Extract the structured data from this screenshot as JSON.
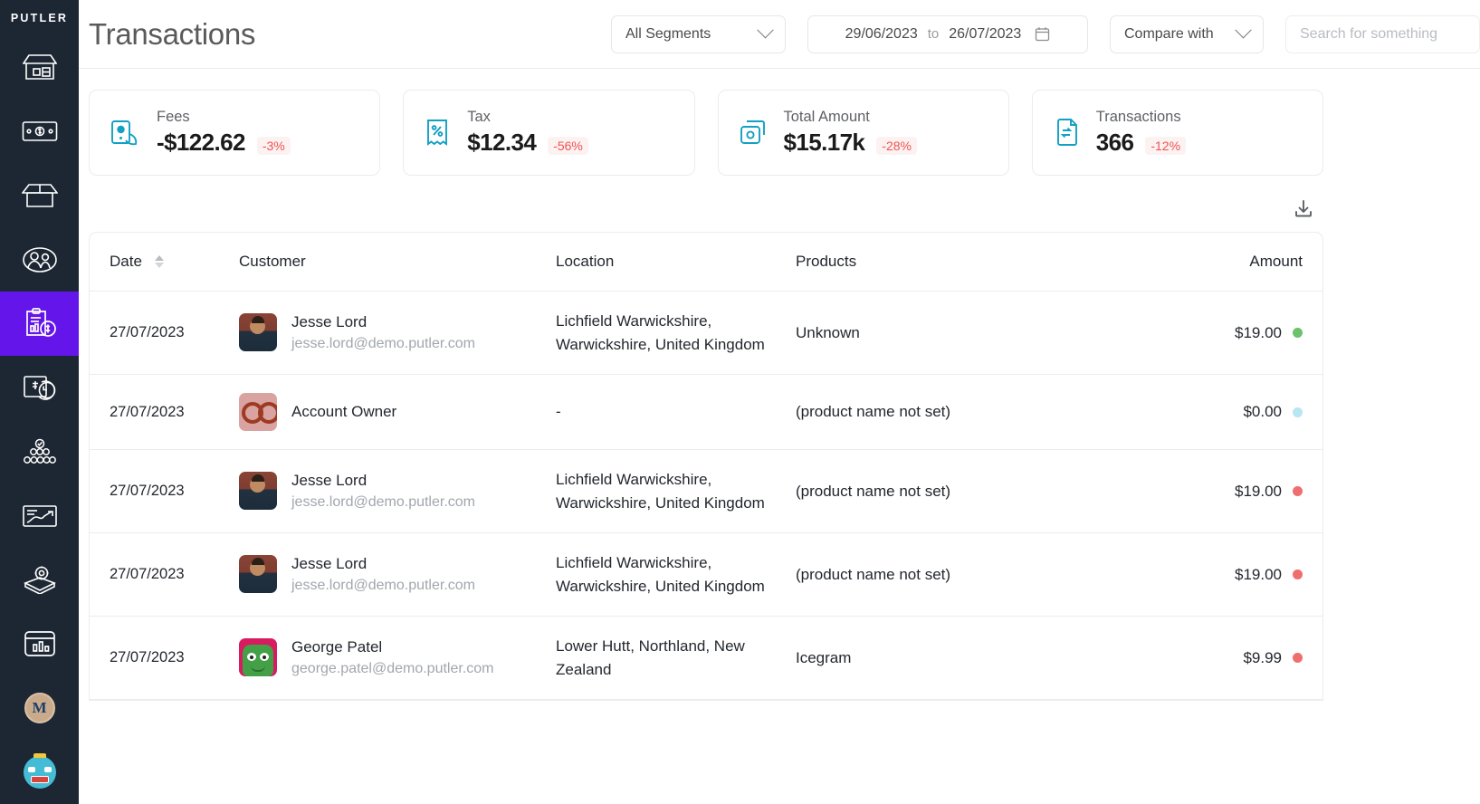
{
  "brand": "PUTLER",
  "sidebar": {
    "items": [
      {
        "name": "store",
        "icon": "store-icon",
        "active": false
      },
      {
        "name": "sales",
        "icon": "money-bill-icon",
        "active": false
      },
      {
        "name": "products",
        "icon": "open-box-icon",
        "active": false
      },
      {
        "name": "customers",
        "icon": "people-icon",
        "active": false
      },
      {
        "name": "transactions",
        "icon": "clipboard-dollar-icon",
        "active": true
      },
      {
        "name": "subscriptions",
        "icon": "refund-dollar-icon",
        "active": false
      },
      {
        "name": "audience",
        "icon": "audience-group-icon",
        "active": false
      },
      {
        "name": "insights",
        "icon": "chart-report-icon",
        "active": false
      },
      {
        "name": "settings",
        "icon": "gear-box-icon",
        "active": false
      },
      {
        "name": "dashboard",
        "icon": "dashboard-card-icon",
        "active": false
      }
    ],
    "account_initial": "M",
    "assistant_icon": "robot-avatar-icon"
  },
  "header": {
    "title": "Transactions",
    "segments": {
      "label": "All Segments",
      "icon": "chevron-down-icon"
    },
    "date_range": {
      "from": "29/06/2023",
      "to_label": "to",
      "to": "26/07/2023",
      "icon": "calendar-icon"
    },
    "compare": {
      "label": "Compare with",
      "icon": "chevron-down-icon"
    },
    "search": {
      "value": "",
      "placeholder": "Search for something"
    }
  },
  "kpis": [
    {
      "label": "Fees",
      "value": "-$122.62",
      "delta": "-3%",
      "icon": "money-bill-icon"
    },
    {
      "label": "Tax",
      "value": "$12.34",
      "delta": "-56%",
      "icon": "tax-receipt-icon"
    },
    {
      "label": "Total Amount",
      "value": "$15.17k",
      "delta": "-28%",
      "icon": "copy-coin-icon"
    },
    {
      "label": "Transactions",
      "value": "366",
      "delta": "-12%",
      "icon": "transfer-doc-icon"
    }
  ],
  "toolbar": {
    "download_icon": "download-icon"
  },
  "table": {
    "columns": [
      {
        "key": "date",
        "label": "Date",
        "sortable": true
      },
      {
        "key": "customer",
        "label": "Customer",
        "sortable": false
      },
      {
        "key": "location",
        "label": "Location",
        "sortable": false
      },
      {
        "key": "products",
        "label": "Products",
        "sortable": false
      },
      {
        "key": "amount",
        "label": "Amount",
        "sortable": false
      }
    ],
    "rows": [
      {
        "date": "27/07/2023",
        "customer_name": "Jesse Lord",
        "customer_email": "jesse.lord@demo.putler.com",
        "avatar": "av-jesse",
        "location": "Lichfield Warwickshire, Warwickshire, United Kingdom",
        "products": "Unknown",
        "amount": "$19.00",
        "status_color": "#6ac26a"
      },
      {
        "date": "27/07/2023",
        "customer_name": "Account Owner",
        "customer_email": "",
        "avatar": "av-owner",
        "location": "-",
        "products": "(product name not set)",
        "amount": "$0.00",
        "status_color": "#b8e6f2"
      },
      {
        "date": "27/07/2023",
        "customer_name": "Jesse Lord",
        "customer_email": "jesse.lord@demo.putler.com",
        "avatar": "av-jesse",
        "location": "Lichfield Warwickshire, Warwickshire, United Kingdom",
        "products": "(product name not set)",
        "amount": "$19.00",
        "status_color": "#ef6e6e"
      },
      {
        "date": "27/07/2023",
        "customer_name": "Jesse Lord",
        "customer_email": "jesse.lord@demo.putler.com",
        "avatar": "av-jesse",
        "location": "Lichfield Warwickshire, Warwickshire, United Kingdom",
        "products": "(product name not set)",
        "amount": "$19.00",
        "status_color": "#ef6e6e"
      },
      {
        "date": "27/07/2023",
        "customer_name": "George Patel",
        "customer_email": "george.patel@demo.putler.com",
        "avatar": "av-george",
        "location": "Lower Hutt, Northland, New Zealand",
        "products": "Icegram",
        "amount": "$9.99",
        "status_color": "#ef6e6e"
      }
    ]
  },
  "colors": {
    "sidebar_bg": "#1d2733",
    "active_nav": "#6315ea",
    "kpi_icon": "#12a0c4",
    "delta_negative": "#ef5350",
    "title_text": "#5a5a5a"
  }
}
